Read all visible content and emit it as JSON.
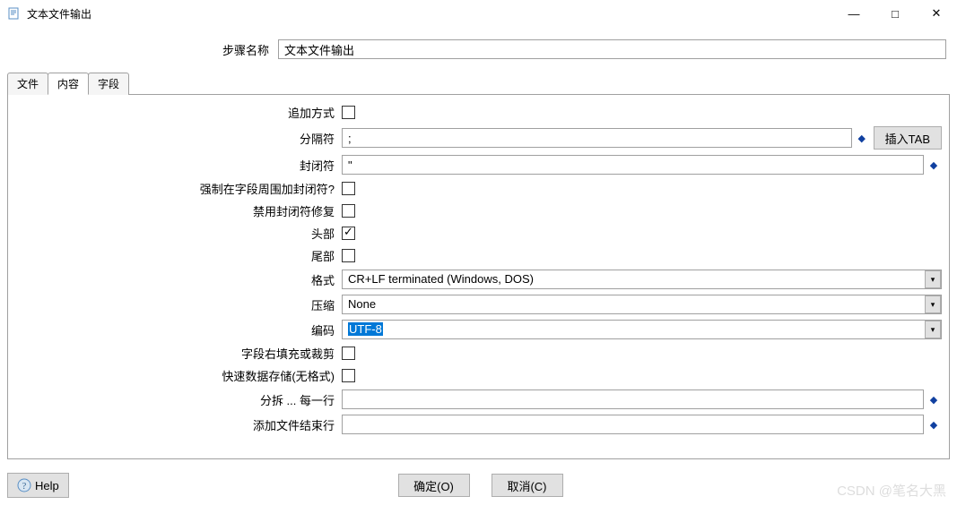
{
  "window": {
    "title": "文本文件输出"
  },
  "step": {
    "label": "步骤名称",
    "value": "文本文件输出"
  },
  "tabs": {
    "file": "文件",
    "content": "内容",
    "fields": "字段"
  },
  "form": {
    "append_label": "追加方式",
    "separator_label": "分隔符",
    "separator_value": ";",
    "insert_tab_btn": "插入TAB",
    "enclosure_label": "封闭符",
    "enclosure_value": "\"",
    "force_enclosure_label": "强制在字段周围加封闭符?",
    "disable_enclosure_fix_label": "禁用封闭符修复",
    "header_label": "头部",
    "footer_label": "尾部",
    "format_label": "格式",
    "format_value": "CR+LF terminated (Windows, DOS)",
    "compression_label": "压缩",
    "compression_value": "None",
    "encoding_label": "编码",
    "encoding_value": "UTF-8",
    "pad_label": "字段右填充或裁剪",
    "fast_dump_label": "快速数据存储(无格式)",
    "split_label": "分拆 ... 每一行",
    "split_value": "",
    "end_line_label": "添加文件结束行",
    "end_line_value": ""
  },
  "buttons": {
    "help": "Help",
    "ok": "确定(O)",
    "cancel": "取消(C)"
  },
  "watermark": "CSDN @笔名大黑"
}
